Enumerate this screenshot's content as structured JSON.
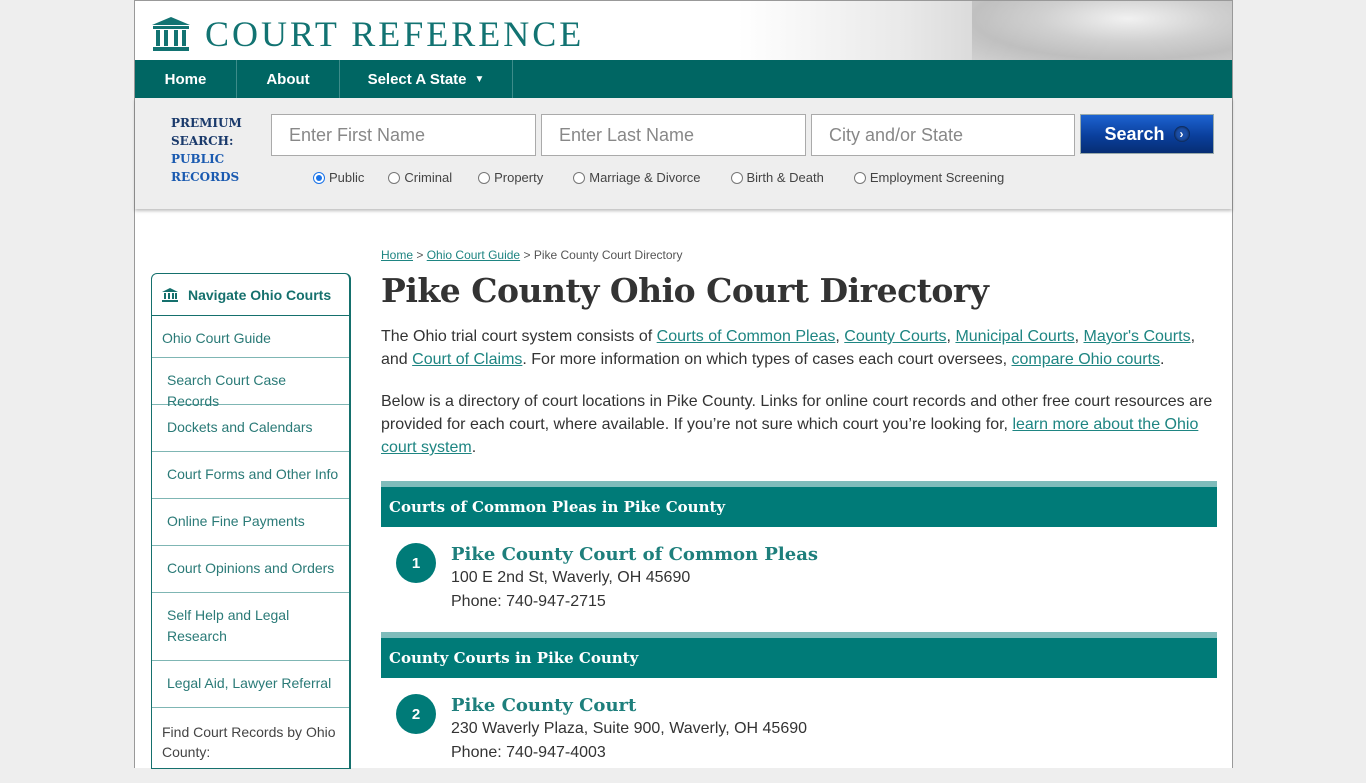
{
  "header": {
    "logo_text": "COURT REFERENCE"
  },
  "nav": {
    "items": [
      {
        "label": "Home"
      },
      {
        "label": "About"
      },
      {
        "label": "Select A State",
        "caret": "▼"
      }
    ]
  },
  "search": {
    "premium_line1": "PREMIUM",
    "premium_line2": "SEARCH:",
    "premium_line3": "PUBLIC",
    "premium_line4": "RECORDS",
    "first_name_placeholder": "Enter First Name",
    "last_name_placeholder": "Enter Last Name",
    "city_placeholder": "City and/or State",
    "button_label": "Search",
    "button_arrow": "›",
    "record_types": [
      {
        "label": "Public",
        "selected": true
      },
      {
        "label": "Criminal",
        "selected": false
      },
      {
        "label": "Property",
        "selected": false
      },
      {
        "label": "Marriage & Divorce",
        "selected": false
      },
      {
        "label": "Birth & Death",
        "selected": false
      },
      {
        "label": "Employment Screening",
        "selected": false
      }
    ]
  },
  "sidebar": {
    "title": "Navigate Ohio Courts",
    "items": [
      {
        "label": "Ohio Court Guide"
      },
      {
        "label": "Search Court Case Records"
      },
      {
        "label": "Dockets and Calendars"
      },
      {
        "label": "Court Forms and Other Info"
      },
      {
        "label": "Online Fine Payments"
      },
      {
        "label": "Court Opinions and Orders"
      },
      {
        "label": "Self Help and Legal Research"
      },
      {
        "label": "Legal Aid, Lawyer Referral"
      }
    ],
    "find_label": "Find Court Records by Ohio County:"
  },
  "breadcrumb": {
    "home": "Home",
    "sep": ">",
    "guide": "Ohio Court Guide",
    "current": "Pike County Court Directory"
  },
  "main": {
    "title": "Pike County Ohio Court Directory",
    "intro": {
      "t1": "The Ohio trial court system consists of ",
      "l1": "Courts of Common Pleas",
      "t2": ", ",
      "l2": "County Courts",
      "t3": ", ",
      "l3": "Municipal Courts",
      "t4": ", ",
      "l4": "Mayor's Courts",
      "t5": ", and ",
      "l5": "Court of Claims",
      "t6": ". For more information on which types of cases each court oversees, ",
      "l6": "compare Ohio courts",
      "t7": "."
    },
    "directory": {
      "t1": "Below is a directory of court locations in Pike County. Links for online court records and other free court resources are provided for each court, where available. If you’re not sure which court you’re looking for, ",
      "l1": "learn more about the Ohio court system",
      "t2": "."
    },
    "sections": [
      {
        "heading": "Courts of Common Pleas in Pike County",
        "courts": [
          {
            "number": "1",
            "name": "Pike County Court of Common Pleas",
            "address": "100 E 2nd St, Waverly, OH 45690",
            "phone": "Phone: 740-947-2715"
          }
        ]
      },
      {
        "heading": "County Courts in Pike County",
        "courts": [
          {
            "number": "2",
            "name": "Pike County Court",
            "address": "230 Waverly Plaza, Suite 900, Waverly, OH 45690",
            "phone": "Phone: 740-947-4003"
          }
        ]
      }
    ]
  },
  "colors": {
    "brand_teal": "#006663",
    "section_teal": "#007b78",
    "link_teal": "#1e8582",
    "search_blue": "#0a3f9c"
  }
}
